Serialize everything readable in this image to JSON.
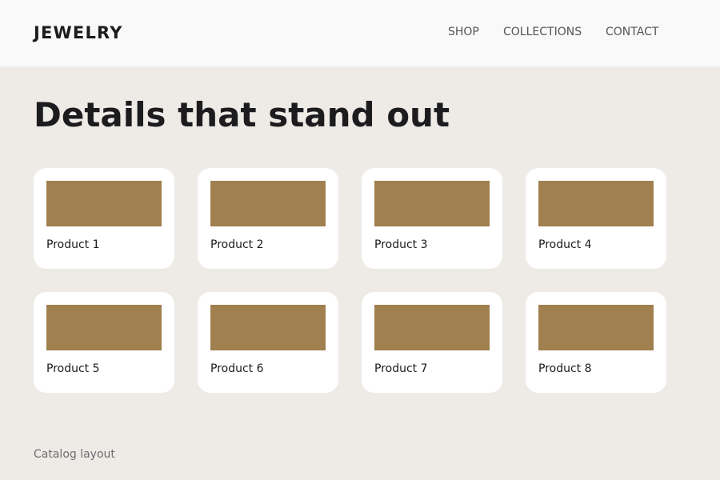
{
  "header": {
    "brand": "JEWELRY",
    "nav": [
      "SHOP",
      "COLLECTIONS",
      "CONTACT"
    ]
  },
  "hero": {
    "title": "Details that stand out"
  },
  "products": [
    {
      "label": "Product 1"
    },
    {
      "label": "Product 2"
    },
    {
      "label": "Product 3"
    },
    {
      "label": "Product 4"
    },
    {
      "label": "Product 5"
    },
    {
      "label": "Product 6"
    },
    {
      "label": "Product 7"
    },
    {
      "label": "Product 8"
    }
  ],
  "footer": {
    "note": "Catalog layout"
  },
  "colors": {
    "page_background": "#eeebe6",
    "header_background": "#f9f9f9",
    "card_background": "#ffffff",
    "product_image_placeholder": "#a0804e",
    "heading_text": "#1c1c1f",
    "nav_text": "#545459",
    "muted_text": "#6d6d73"
  }
}
